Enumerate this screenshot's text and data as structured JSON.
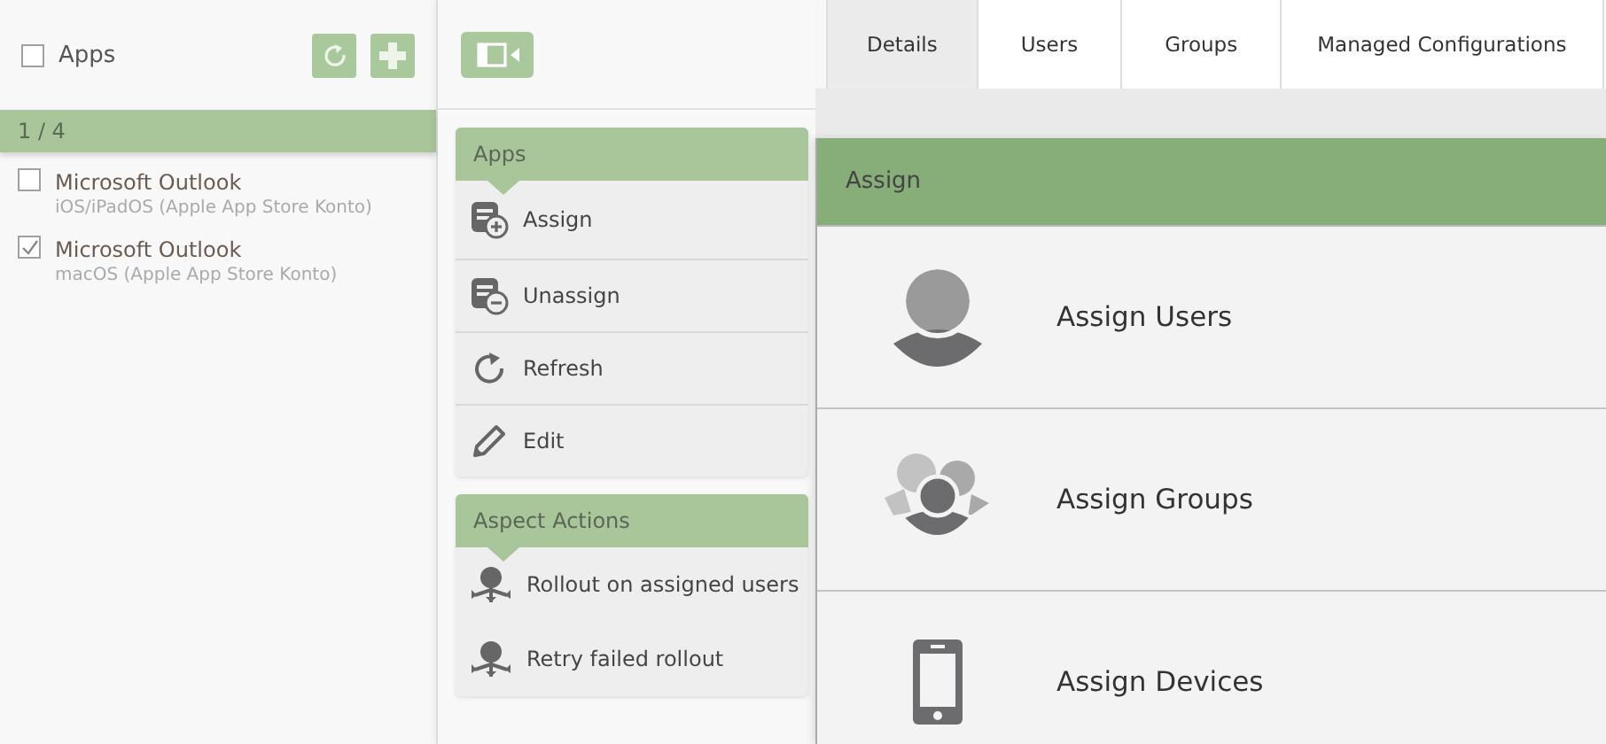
{
  "list": {
    "header": {
      "label": "Apps",
      "checked": false
    },
    "count": "1 / 4",
    "items": [
      {
        "title": "Microsoft Outlook",
        "subtitle": "iOS/iPadOS (Apple App Store Konto)",
        "checked": false
      },
      {
        "title": "Microsoft Outlook",
        "subtitle": "macOS (Apple App Store Konto)",
        "checked": true
      }
    ]
  },
  "menu": [
    {
      "title": "Apps",
      "items": [
        {
          "label": "Assign",
          "kind": "assign"
        },
        {
          "label": "Unassign",
          "kind": "unassign"
        },
        {
          "label": "Refresh",
          "kind": "refresh"
        },
        {
          "label": "Edit",
          "kind": "edit"
        }
      ]
    },
    {
      "title": "Aspect Actions",
      "items": [
        {
          "label": "Rollout on assigned users",
          "kind": "rollout"
        },
        {
          "label": "Retry failed rollout",
          "kind": "rollout"
        }
      ]
    }
  ],
  "tabs": [
    {
      "label": "Details",
      "selected": true
    },
    {
      "label": "Users",
      "selected": false
    },
    {
      "label": "Groups",
      "selected": false
    },
    {
      "label": "Managed Configurations",
      "selected": false
    }
  ],
  "dialog": {
    "title": "Assign",
    "options": [
      {
        "label": "Assign Users",
        "kind": "user"
      },
      {
        "label": "Assign Groups",
        "kind": "group"
      },
      {
        "label": "Assign Devices",
        "kind": "device"
      }
    ]
  }
}
